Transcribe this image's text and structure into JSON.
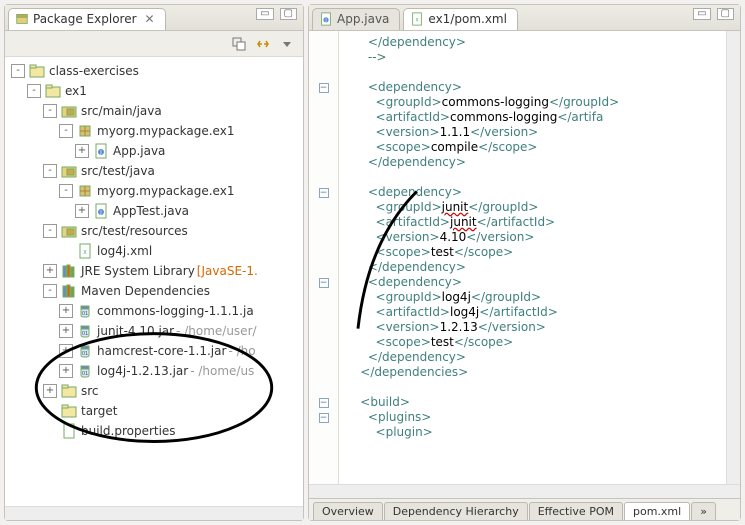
{
  "left_panel": {
    "tab_title": "Package Explorer",
    "toolbar_icons": [
      "collapse-all-icon",
      "link-editor-icon",
      "view-menu-icon"
    ]
  },
  "tree": [
    {
      "depth": 0,
      "tw": "-",
      "icon": "project",
      "label": "class-exercises"
    },
    {
      "depth": 1,
      "tw": "-",
      "icon": "project",
      "label": "ex1"
    },
    {
      "depth": 2,
      "tw": "-",
      "icon": "srcfolder",
      "label": "src/main/java"
    },
    {
      "depth": 3,
      "tw": "-",
      "icon": "package",
      "label": "myorg.mypackage.ex1"
    },
    {
      "depth": 4,
      "tw": "+",
      "icon": "javafile",
      "label": "App.java"
    },
    {
      "depth": 2,
      "tw": "-",
      "icon": "srcfolder",
      "label": "src/test/java"
    },
    {
      "depth": 3,
      "tw": "-",
      "icon": "package",
      "label": "myorg.mypackage.ex1"
    },
    {
      "depth": 4,
      "tw": "+",
      "icon": "javafile",
      "label": "AppTest.java"
    },
    {
      "depth": 2,
      "tw": "-",
      "icon": "srcfolder",
      "label": "src/test/resources"
    },
    {
      "depth": 3,
      "tw": " ",
      "icon": "xmlfile",
      "label": "log4j.xml"
    },
    {
      "depth": 2,
      "tw": "+",
      "icon": "library",
      "label": "JRE System Library",
      "hint": "[JavaSE-1."
    },
    {
      "depth": 2,
      "tw": "-",
      "icon": "library",
      "label": "Maven Dependencies"
    },
    {
      "depth": 3,
      "tw": "+",
      "icon": "jar",
      "label": "commons-logging-1.1.1.ja"
    },
    {
      "depth": 3,
      "tw": "+",
      "icon": "jar",
      "label": "junit-4.10.jar",
      "hint": "- /home/user/"
    },
    {
      "depth": 3,
      "tw": "+",
      "icon": "jar",
      "label": "hamcrest-core-1.1.jar",
      "hint": "- /ho"
    },
    {
      "depth": 3,
      "tw": "+",
      "icon": "jar",
      "label": "log4j-1.2.13.jar",
      "hint": "- /home/us"
    },
    {
      "depth": 2,
      "tw": "+",
      "icon": "folder",
      "label": "src"
    },
    {
      "depth": 2,
      "tw": " ",
      "icon": "folder",
      "label": "target"
    },
    {
      "depth": 2,
      "tw": " ",
      "icon": "file",
      "label": "build.properties"
    }
  ],
  "editor_tabs": [
    {
      "label": "App.java",
      "active": false,
      "icon": "javafile"
    },
    {
      "label": "ex1/pom.xml",
      "active": true,
      "icon": "xmlfile"
    }
  ],
  "bottom_tabs": [
    "Overview",
    "Dependency Hierarchy",
    "Effective POM",
    "pom.xml"
  ],
  "bottom_active": 3,
  "code_lines": [
    {
      "fold": "",
      "indent": 6,
      "tokens": [
        {
          "c": "t-tag",
          "t": "</dependency>"
        }
      ]
    },
    {
      "fold": "",
      "indent": 6,
      "tokens": [
        {
          "c": "t-cmt",
          "t": "-->"
        }
      ]
    },
    {
      "fold": "",
      "indent": 0,
      "tokens": []
    },
    {
      "fold": "-",
      "indent": 6,
      "tokens": [
        {
          "c": "t-tag",
          "t": "<dependency>"
        }
      ]
    },
    {
      "fold": "",
      "indent": 8,
      "tokens": [
        {
          "c": "t-tag",
          "t": "<groupId>"
        },
        {
          "c": "t-attr",
          "t": "commons-logging"
        },
        {
          "c": "t-tag",
          "t": "</groupId>"
        }
      ]
    },
    {
      "fold": "",
      "indent": 8,
      "tokens": [
        {
          "c": "t-tag",
          "t": "<artifactId>"
        },
        {
          "c": "t-attr",
          "t": "commons-logging"
        },
        {
          "c": "t-tag",
          "t": "</artifa"
        }
      ]
    },
    {
      "fold": "",
      "indent": 8,
      "tokens": [
        {
          "c": "t-tag",
          "t": "<version>"
        },
        {
          "c": "t-attr",
          "t": "1.1.1"
        },
        {
          "c": "t-tag",
          "t": "</version>"
        }
      ]
    },
    {
      "fold": "",
      "indent": 8,
      "tokens": [
        {
          "c": "t-tag",
          "t": "<scope>"
        },
        {
          "c": "t-attr",
          "t": "compile"
        },
        {
          "c": "t-tag",
          "t": "</scope>"
        }
      ]
    },
    {
      "fold": "",
      "indent": 6,
      "tokens": [
        {
          "c": "t-tag",
          "t": "</dependency>"
        }
      ]
    },
    {
      "fold": "",
      "indent": 0,
      "tokens": []
    },
    {
      "fold": "-",
      "indent": 6,
      "tokens": [
        {
          "c": "t-tag",
          "t": "<dependency>"
        }
      ]
    },
    {
      "fold": "",
      "indent": 8,
      "tokens": [
        {
          "c": "t-tag",
          "t": "<groupId>"
        },
        {
          "c": "t-attr red-und",
          "t": "junit"
        },
        {
          "c": "t-tag",
          "t": "</groupId>"
        }
      ]
    },
    {
      "fold": "",
      "indent": 8,
      "tokens": [
        {
          "c": "t-tag",
          "t": "<artifactId>"
        },
        {
          "c": "t-attr red-und",
          "t": "junit"
        },
        {
          "c": "t-tag",
          "t": "</artifactId>"
        }
      ]
    },
    {
      "fold": "",
      "indent": 8,
      "tokens": [
        {
          "c": "t-tag",
          "t": "<version>"
        },
        {
          "c": "t-attr",
          "t": "4.10"
        },
        {
          "c": "t-tag",
          "t": "</version>"
        }
      ]
    },
    {
      "fold": "",
      "indent": 8,
      "tokens": [
        {
          "c": "t-tag",
          "t": "<scope>"
        },
        {
          "c": "t-attr",
          "t": "test"
        },
        {
          "c": "t-tag",
          "t": "</scope>"
        }
      ]
    },
    {
      "fold": "",
      "indent": 6,
      "tokens": [
        {
          "c": "t-tag",
          "t": "</dependency>"
        }
      ]
    },
    {
      "fold": "-",
      "indent": 6,
      "tokens": [
        {
          "c": "t-tag",
          "t": "<dependency>"
        }
      ]
    },
    {
      "fold": "",
      "indent": 8,
      "tokens": [
        {
          "c": "t-tag",
          "t": "<groupId>"
        },
        {
          "c": "t-attr",
          "t": "log4j"
        },
        {
          "c": "t-tag",
          "t": "</groupId>"
        }
      ]
    },
    {
      "fold": "",
      "indent": 8,
      "tokens": [
        {
          "c": "t-tag",
          "t": "<artifactId>"
        },
        {
          "c": "t-attr",
          "t": "log4j"
        },
        {
          "c": "t-tag",
          "t": "</artifactId>"
        }
      ]
    },
    {
      "fold": "",
      "indent": 8,
      "tokens": [
        {
          "c": "t-tag",
          "t": "<version>"
        },
        {
          "c": "t-attr",
          "t": "1.2.13"
        },
        {
          "c": "t-tag",
          "t": "</version>"
        }
      ]
    },
    {
      "fold": "",
      "indent": 8,
      "tokens": [
        {
          "c": "t-tag",
          "t": "<scope>"
        },
        {
          "c": "t-attr",
          "t": "test"
        },
        {
          "c": "t-tag",
          "t": "</scope>"
        }
      ]
    },
    {
      "fold": "",
      "indent": 6,
      "tokens": [
        {
          "c": "t-tag",
          "t": "</dependency>"
        }
      ]
    },
    {
      "fold": "",
      "indent": 4,
      "tokens": [
        {
          "c": "t-tag",
          "t": "</dependencies>"
        }
      ]
    },
    {
      "fold": "",
      "indent": 0,
      "tokens": []
    },
    {
      "fold": "-",
      "indent": 4,
      "tokens": [
        {
          "c": "t-tag",
          "t": "<build>"
        }
      ]
    },
    {
      "fold": "-",
      "indent": 6,
      "tokens": [
        {
          "c": "t-tag",
          "t": "<plugins>"
        }
      ]
    },
    {
      "fold": "",
      "indent": 8,
      "tokens": [
        {
          "c": "t-tag",
          "t": "<plugin>"
        }
      ]
    }
  ]
}
